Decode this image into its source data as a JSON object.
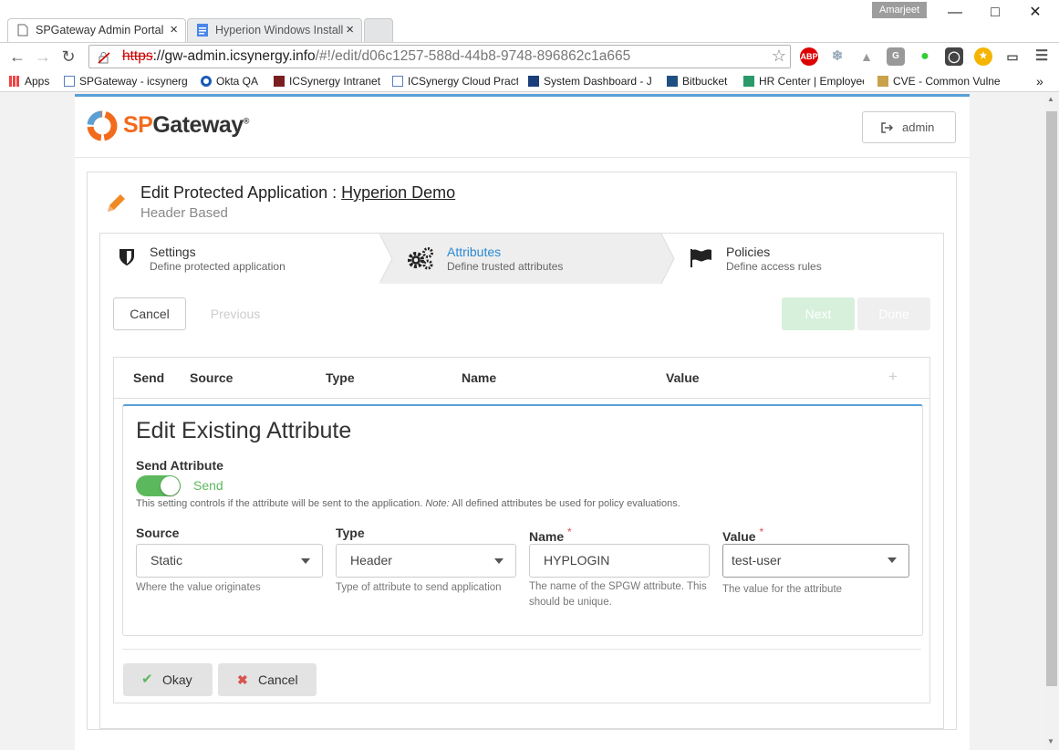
{
  "browser": {
    "user": "Amarjeet",
    "tabs": [
      {
        "label": "SPGateway Admin Portal",
        "close": "×"
      },
      {
        "label": "Hyperion Windows Install",
        "close": "×"
      }
    ],
    "url": {
      "scheme": "https",
      "host": "://gw-admin.icsynergy.info",
      "path": "/#!/edit/d06c1257-588d-44b8-9748-896862c1a665"
    },
    "extensions": {
      "abp": "ABP",
      "g": "G"
    },
    "bookmarks": [
      "Apps",
      "SPGateway - icsynerg",
      "Okta QA",
      "ICSynergy Intranet",
      "ICSynergy Cloud Pract",
      "System Dashboard - J",
      "Bitbucket",
      "HR Center | Employee",
      "CVE - Common Vulne"
    ],
    "overflow": "»"
  },
  "app": {
    "logo_sp": "SP",
    "logo_rest": "Gateway",
    "logo_reg": "®",
    "admin_label": "admin"
  },
  "page": {
    "title_prefix": "Edit Protected Application : ",
    "app_name": "Hyperion Demo",
    "subtitle": "Header Based"
  },
  "steps": [
    {
      "title": "Settings",
      "desc": "Define protected application"
    },
    {
      "title": "Attributes",
      "desc": "Define trusted attributes"
    },
    {
      "title": "Policies",
      "desc": "Define access rules"
    }
  ],
  "wizard_buttons": {
    "cancel": "Cancel",
    "previous": "Previous",
    "next": "Next",
    "done": "Done"
  },
  "table": {
    "headers": [
      "Send",
      "Source",
      "Type",
      "Name",
      "Value"
    ],
    "add": "+"
  },
  "edit_attribute": {
    "title": "Edit Existing Attribute",
    "send_label": "Send Attribute",
    "send_state": "Send",
    "help_prefix": "This setting controls if the attribute will be sent to the application. ",
    "help_note": "Note:",
    "help_suffix": " All defined attributes be used for policy evaluations.",
    "source": {
      "label": "Source",
      "value": "Static",
      "help": "Where the value originates"
    },
    "type": {
      "label": "Type",
      "value": "Header",
      "help": "Type of attribute to send application"
    },
    "name": {
      "label": "Name",
      "required": "*",
      "value": "HYPLOGIN",
      "help": "The name of the SPGW attribute. This should be unique."
    },
    "value": {
      "label": "Value",
      "required": "*",
      "value": "test-user",
      "help": "The value for the attribute"
    },
    "okay": "Okay",
    "cancel": "Cancel"
  },
  "colors": {
    "accent": "#5aa0d6",
    "success": "#5cb85c",
    "danger": "#d9534f",
    "brand_orange": "#f26b1d"
  }
}
